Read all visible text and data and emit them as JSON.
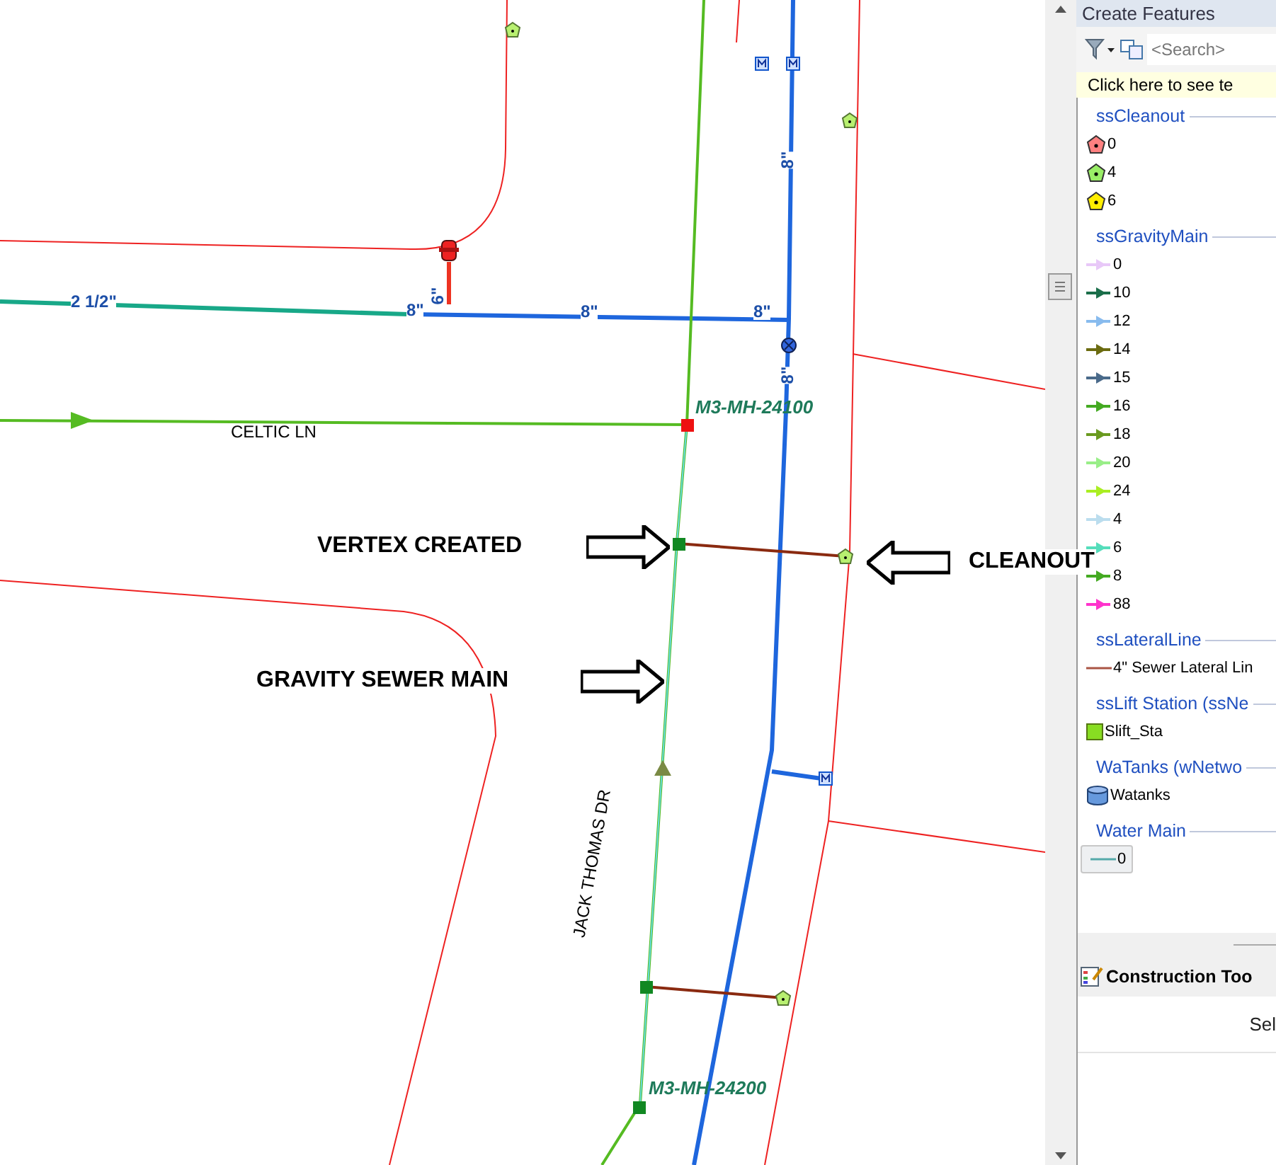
{
  "map": {
    "pipe_sizes": [
      "2 1/2\"",
      "8\"",
      "8\"",
      "8\"",
      "6\"",
      "8\"",
      "8\""
    ],
    "manhole_ids": [
      "M3-MH-24100",
      "M3-MH-24200"
    ],
    "street_names": [
      "CELTIC LN",
      "JACK THOMAS DR"
    ],
    "callouts": [
      "VERTEX CREATED",
      "GRAVITY SEWER MAIN",
      "CLEANOUT"
    ]
  },
  "panel": {
    "title": "Create Features",
    "search": {
      "placeholder": "<Search>"
    },
    "notice": "Click here to see te",
    "groups": [
      {
        "name": "ssCleanout",
        "items": [
          {
            "label": "0",
            "kind": "pentagon",
            "color": "#ff8080",
            "selected": false
          },
          {
            "label": "4",
            "kind": "pentagon",
            "color": "#99ee66",
            "selected": false
          },
          {
            "label": "6",
            "kind": "pentagon",
            "color": "#ffee00",
            "selected": false
          }
        ]
      },
      {
        "name": "ssGravityMain",
        "items": [
          {
            "label": "0",
            "kind": "arrow",
            "color": "#e8c8f8",
            "selected": false
          },
          {
            "label": "10",
            "kind": "arrow",
            "color": "#1b6e4a",
            "selected": false
          },
          {
            "label": "12",
            "kind": "arrow",
            "color": "#88bbee",
            "selected": false
          },
          {
            "label": "14",
            "kind": "arrow",
            "color": "#6b6b10",
            "selected": false
          },
          {
            "label": "15",
            "kind": "arrow",
            "color": "#4a6a8a",
            "selected": false
          },
          {
            "label": "16",
            "kind": "arrow",
            "color": "#44aa22",
            "selected": false
          },
          {
            "label": "18",
            "kind": "arrow",
            "color": "#6a9a20",
            "selected": false
          },
          {
            "label": "20",
            "kind": "arrow",
            "color": "#99ee88",
            "selected": false
          },
          {
            "label": "24",
            "kind": "arrow",
            "color": "#aaee22",
            "selected": false
          },
          {
            "label": "4",
            "kind": "arrow",
            "color": "#bbddee",
            "selected": false
          },
          {
            "label": "6",
            "kind": "arrow",
            "color": "#55ddbb",
            "selected": false
          },
          {
            "label": "8",
            "kind": "arrow",
            "color": "#44aa22",
            "selected": false
          },
          {
            "label": "88",
            "kind": "arrow",
            "color": "#ff33cc",
            "selected": false
          }
        ]
      },
      {
        "name": "ssLateralLine",
        "items": [
          {
            "label": "4\" Sewer Lateral Lin",
            "kind": "line",
            "color": "#aa5544",
            "selected": false
          }
        ]
      },
      {
        "name": "ssLift Station (ssNe",
        "items": [
          {
            "label": "Slift_Sta",
            "kind": "square",
            "color": "#88dd22",
            "selected": false
          }
        ]
      },
      {
        "name": "WaTanks (wNetwo",
        "items": [
          {
            "label": "Watanks",
            "kind": "cylinder",
            "color": "#6699dd",
            "selected": false
          }
        ]
      },
      {
        "name": "Water Main",
        "items": [
          {
            "label": "0",
            "kind": "line",
            "color": "#55aaaa",
            "selected": true
          }
        ]
      }
    ],
    "tools": {
      "title": "Construction Too",
      "hint": "Sel"
    }
  }
}
